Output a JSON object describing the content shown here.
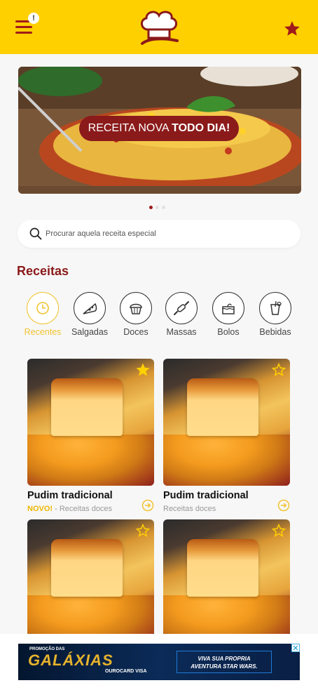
{
  "header": {
    "menu_badge": "!",
    "colors": {
      "bar": "#ffd000",
      "accent": "#a11a1a"
    }
  },
  "banner": {
    "label_normal": "RECEITA NOVA ",
    "label_bold": "TODO DIA!",
    "pages": 3,
    "active_page": 1
  },
  "search": {
    "placeholder": "Procurar aquela receita especial"
  },
  "section": {
    "title": "Receitas"
  },
  "categories": [
    {
      "label": "Recentes",
      "icon": "clock-icon",
      "active": true
    },
    {
      "label": "Salgadas",
      "icon": "pizza-slice-icon",
      "active": false
    },
    {
      "label": "Doces",
      "icon": "muffin-icon",
      "active": false
    },
    {
      "label": "Massas",
      "icon": "rolling-pin-icon",
      "active": false
    },
    {
      "label": "Bolos",
      "icon": "cake-icon",
      "active": false
    },
    {
      "label": "Bebidas",
      "icon": "drink-glass-icon",
      "active": false
    }
  ],
  "recipes": [
    {
      "title": "Pudim tradicional",
      "badge": "NOVO!",
      "separator": " - ",
      "category": "Receitas doces",
      "favorited": true
    },
    {
      "title": "Pudim tradicional",
      "badge": "",
      "separator": "",
      "category": "Receitas doces",
      "favorited": false
    },
    {
      "title": "",
      "badge": "",
      "separator": "",
      "category": "",
      "favorited": false
    },
    {
      "title": "",
      "badge": "",
      "separator": "",
      "category": "",
      "favorited": false
    }
  ],
  "ad": {
    "top": "PROMOÇÃO DAS",
    "brand": "GALÁXIAS",
    "sub": "OUROCARD VISA",
    "promo_line1": "VIVA SUA PROPRIA",
    "promo_line2": "AVENTURA STAR WARS."
  }
}
